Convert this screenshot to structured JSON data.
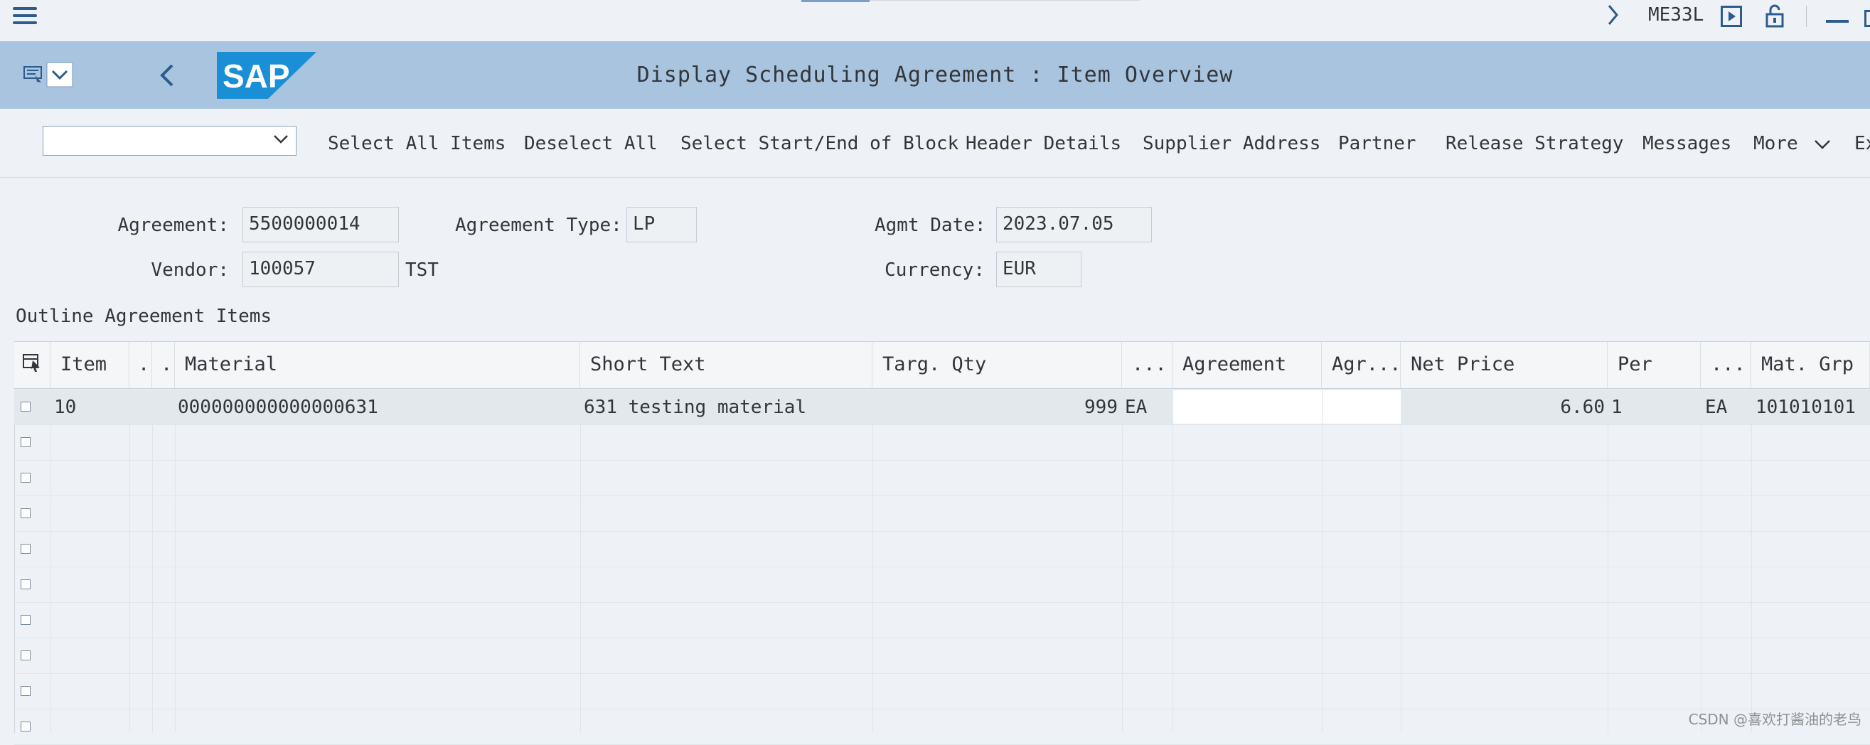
{
  "topbar": {
    "transaction_code": "ME33L",
    "icons": [
      "menu-icon",
      "chevron-right-icon",
      "play-icon",
      "unlock-icon",
      "minimize-icon"
    ]
  },
  "titlebar": {
    "title": "Display Scheduling Agreement : Item Overview",
    "logo_text": "SAP"
  },
  "toolbar": {
    "select_value": "",
    "buttons": [
      "Select All Items",
      "Deselect All",
      "Select Start/End of Block",
      "Header Details",
      "Supplier Address",
      "Partner",
      "Release Strategy",
      "Messages",
      "More",
      "Ex"
    ]
  },
  "header": {
    "agreement_label": "Agreement:",
    "agreement_value": "5500000014",
    "agreement_type_label": "Agreement Type:",
    "agreement_type_value": "LP",
    "agmt_date_label": "Agmt Date:",
    "agmt_date_value": "2023.07.05",
    "vendor_label": "Vendor:",
    "vendor_value": "100057",
    "vendor_name": "TST",
    "currency_label": "Currency:",
    "currency_value": "EUR"
  },
  "items": {
    "section_title": "Outline Agreement Items",
    "columns": [
      "Item",
      ".",
      ".",
      "Material",
      "Short Text",
      "Targ. Qty",
      "...",
      "Agreement",
      "Agr...",
      "Net Price",
      "Per",
      "...",
      "Mat. Grp"
    ],
    "rows": [
      {
        "item": "10",
        "material": "000000000000000631",
        "short_text": "631 testing material",
        "targ_qty": "999",
        "unit": "EA",
        "agreement": "",
        "agr": "",
        "net_price": "6.60",
        "per": "1",
        "order_unit": "EA",
        "mat_grp": "101010101"
      }
    ]
  },
  "watermark": "CSDN @喜欢打酱油的老鸟"
}
